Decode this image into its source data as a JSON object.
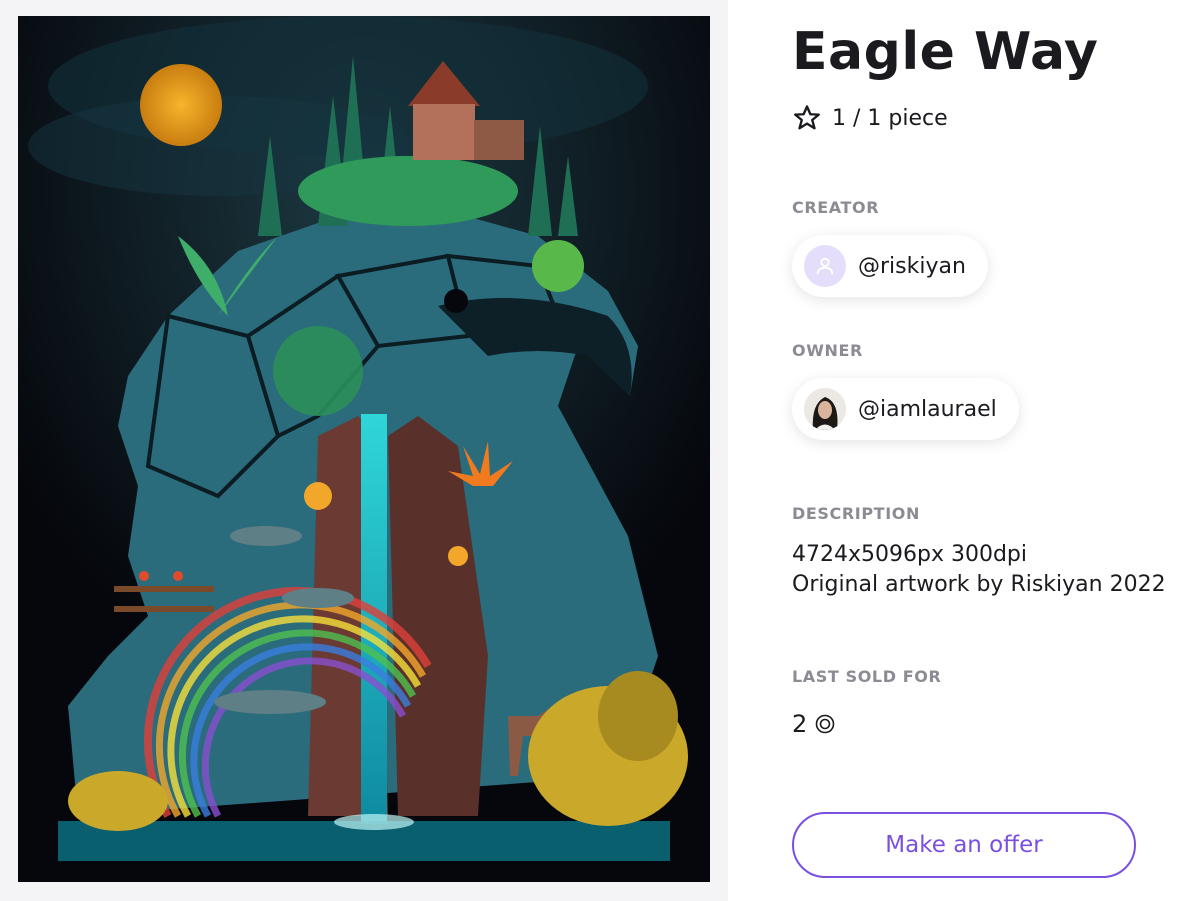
{
  "artwork": {
    "colors": {
      "background": "#05070c",
      "moon": "#f4a724",
      "rock": "#2a6b7c",
      "waterfall": "#35e0e0",
      "cliff": "#6b3a32",
      "foliage": "#2f9a5a",
      "flowers": "#f07a1e",
      "shrubs": "#c9a82a"
    }
  },
  "details": {
    "title": "Eagle Way",
    "edition": {
      "icon": "star-outline-icon",
      "text": "1 / 1 piece"
    },
    "creator": {
      "label": "CREATOR",
      "handle": "@riskiyan",
      "avatar": "user-placeholder-icon"
    },
    "owner": {
      "label": "OWNER",
      "handle": "@iamlaurael",
      "avatar": "user-photo-avatar"
    },
    "description": {
      "label": "DESCRIPTION",
      "line1": "4724x5096px 300dpi",
      "line2": "Original artwork by Riskiyan 2022"
    },
    "last_sold": {
      "label": "LAST SOLD FOR",
      "value": "2",
      "currency_icon": "currency-circle-icon"
    },
    "offer_button": {
      "label": "Make an offer",
      "color": "#7b4fe0"
    }
  }
}
